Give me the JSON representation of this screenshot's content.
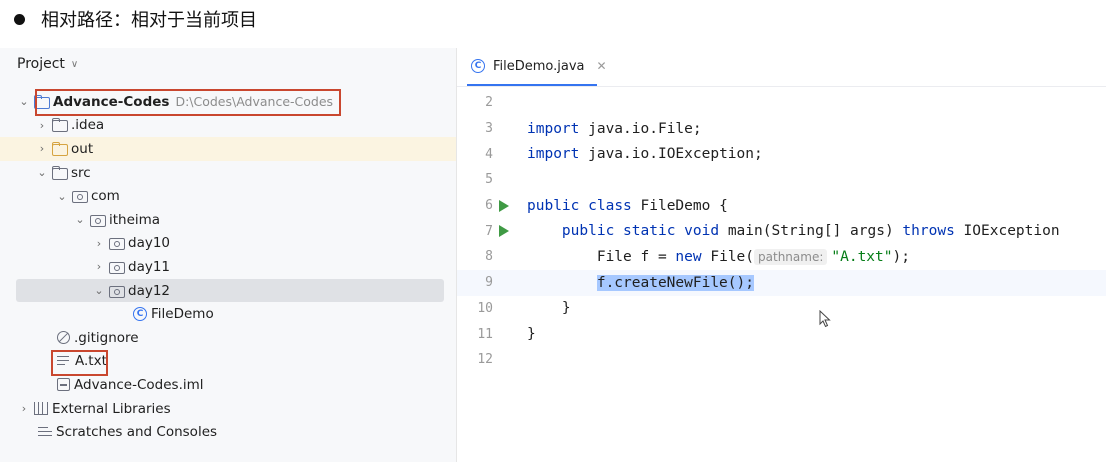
{
  "heading": "相对路径：相对于当前项目",
  "project_panel": {
    "title": "Project",
    "tree": {
      "root": {
        "name": "Advance-Codes",
        "path": "D:\\Codes\\Advance-Codes"
      },
      "idea": ".idea",
      "out": "out",
      "src": "src",
      "com": "com",
      "itheima": "itheima",
      "day10": "day10",
      "day11": "day11",
      "day12": "day12",
      "filedemo": "FileDemo",
      "gitignore": ".gitignore",
      "atxt": "A.txt",
      "iml": "Advance-Codes.iml",
      "external": "External Libraries",
      "scratches": "Scratches and Consoles"
    }
  },
  "editor": {
    "tab_name": "FileDemo.java",
    "lines": [
      {
        "no": "2"
      },
      {
        "no": "3",
        "kw": "import",
        "text": " java.io.File;"
      },
      {
        "no": "4",
        "kw": "import",
        "text": " java.io.IOException;"
      },
      {
        "no": "5"
      },
      {
        "no": "6",
        "kw1": "public",
        "kw2": "class",
        "text": " FileDemo {"
      },
      {
        "no": "7",
        "kw1": "public",
        "kw2": "static",
        "kw3": "void",
        "text_a": " main(String[] args) ",
        "kw4": "throws",
        "text_b": " IOException"
      },
      {
        "no": "8",
        "pre": "File f = ",
        "kw": "new",
        "mid": " File(",
        "hint": "pathname:",
        "str": "\"A.txt\"",
        "post": ");"
      },
      {
        "no": "9",
        "sel": "f.createNewFile();"
      },
      {
        "no": "10",
        "text": "}"
      },
      {
        "no": "11",
        "text": "}"
      },
      {
        "no": "12"
      }
    ]
  },
  "colors": {
    "keyword": "#0033b3",
    "string": "#067d17",
    "selection": "#a6c8ff",
    "highlight_box": "#c9472f",
    "run_icon": "#3f9a44"
  }
}
